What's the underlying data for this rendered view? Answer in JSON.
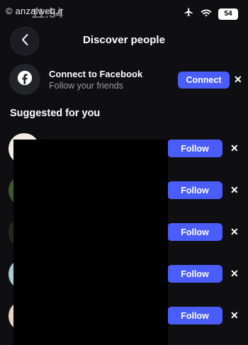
{
  "watermark": "© anzalweb.ir",
  "status": {
    "time": "11:54",
    "battery": "54"
  },
  "header": {
    "title": "Discover people"
  },
  "facebook": {
    "title": "Connect to Facebook",
    "subtitle": "Follow your friends",
    "button": "Connect"
  },
  "suggested": {
    "title": "Suggested for you",
    "items": [
      {
        "button": "Follow"
      },
      {
        "button": "Follow"
      },
      {
        "button": "Follow"
      },
      {
        "button": "Follow"
      },
      {
        "button": "Follow"
      }
    ]
  },
  "icons": {
    "back": "chevron-left-icon",
    "facebook": "facebook-icon",
    "dismiss": "close-icon"
  },
  "colors": {
    "accent": "#4a5df9",
    "background": "#0f0f12"
  }
}
